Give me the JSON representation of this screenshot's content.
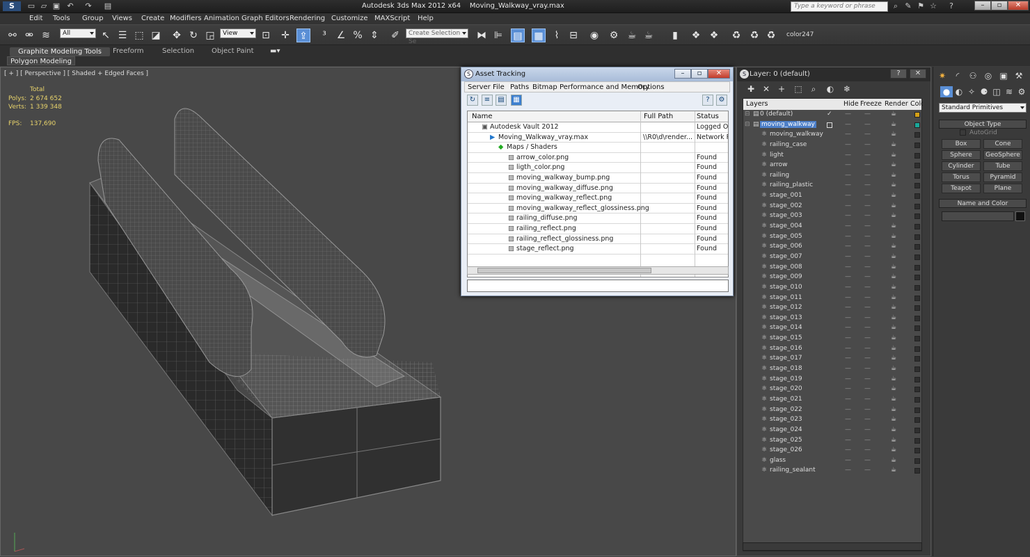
{
  "app_title": "Autodesk 3ds Max  2012 x64",
  "file_title": "Moving_Walkway_vray.max",
  "search_placeholder": "Type a keyword or phrase",
  "menu": [
    "Edit",
    "Tools",
    "Group",
    "Views",
    "Create",
    "Modifiers",
    "Animation",
    "Graph Editors",
    "Rendering",
    "Customize",
    "MAXScript",
    "Help"
  ],
  "toolbar": {
    "filter_value": "All",
    "refcoord_value": "View",
    "selection_set_placeholder": "Create Selection Se",
    "color_label": "color247"
  },
  "ribbon": {
    "tabs": [
      "Graphite Modeling Tools",
      "Freeform",
      "Selection",
      "Object Paint"
    ],
    "sub_tab": "Polygon Modeling"
  },
  "viewport": {
    "label": "[ + ] [ Perspective ] [ Shaded + Edged Faces ]",
    "stats": {
      "header": "Total",
      "polys_label": "Polys:",
      "polys": "2 674 652",
      "verts_label": "Verts:",
      "verts": "1 339 348",
      "fps_label": "FPS:",
      "fps": "137,690"
    }
  },
  "asset_tracking": {
    "title": "Asset Tracking",
    "menu": [
      "Server",
      "File",
      "Paths",
      "Bitmap Performance and Memory",
      "Options"
    ],
    "columns": [
      "Name",
      "Full Path",
      "Status"
    ],
    "rows": [
      {
        "name": "Autodesk Vault 2012",
        "path": "",
        "status": "Logged Ou",
        "indent": 0
      },
      {
        "name": "Moving_Walkway_vray.max",
        "path": "\\\\R0\\d\\render...",
        "status": "Network Pa",
        "indent": 1
      },
      {
        "name": "Maps / Shaders",
        "path": "",
        "status": "",
        "indent": 2
      },
      {
        "name": "arrow_color.png",
        "path": "",
        "status": "Found",
        "indent": 3
      },
      {
        "name": "ligth_color.png",
        "path": "",
        "status": "Found",
        "indent": 3
      },
      {
        "name": "moving_walkway_bump.png",
        "path": "",
        "status": "Found",
        "indent": 3
      },
      {
        "name": "moving_walkway_diffuse.png",
        "path": "",
        "status": "Found",
        "indent": 3
      },
      {
        "name": "moving_walkway_reflect.png",
        "path": "",
        "status": "Found",
        "indent": 3
      },
      {
        "name": "moving_walkway_reflect_glossiness.png",
        "path": "",
        "status": "Found",
        "indent": 3
      },
      {
        "name": "railing_diffuse.png",
        "path": "",
        "status": "Found",
        "indent": 3
      },
      {
        "name": "railing_reflect.png",
        "path": "",
        "status": "Found",
        "indent": 3
      },
      {
        "name": "railing_reflect_glossiness.png",
        "path": "",
        "status": "Found",
        "indent": 3
      },
      {
        "name": "stage_reflect.png",
        "path": "",
        "status": "Found",
        "indent": 3
      }
    ]
  },
  "layers": {
    "title": "Layer: 0 (default)",
    "columns": [
      "Layers",
      "Hide",
      "Freeze",
      "Render",
      "Color"
    ],
    "rows": [
      {
        "name": "0 (default)",
        "level": 0,
        "check": "✓",
        "color": "#d4a017"
      },
      {
        "name": "moving_walkway",
        "level": 0,
        "selected": true,
        "color": "#1aa89a"
      },
      {
        "name": "moving_walkway",
        "level": 1
      },
      {
        "name": "railing_case",
        "level": 1
      },
      {
        "name": "light",
        "level": 1
      },
      {
        "name": "arrow",
        "level": 1
      },
      {
        "name": "railing",
        "level": 1
      },
      {
        "name": "railing_plastic",
        "level": 1
      },
      {
        "name": "stage_001",
        "level": 1
      },
      {
        "name": "stage_002",
        "level": 1
      },
      {
        "name": "stage_003",
        "level": 1
      },
      {
        "name": "stage_004",
        "level": 1
      },
      {
        "name": "stage_005",
        "level": 1
      },
      {
        "name": "stage_006",
        "level": 1
      },
      {
        "name": "stage_007",
        "level": 1
      },
      {
        "name": "stage_008",
        "level": 1
      },
      {
        "name": "stage_009",
        "level": 1
      },
      {
        "name": "stage_010",
        "level": 1
      },
      {
        "name": "stage_011",
        "level": 1
      },
      {
        "name": "stage_012",
        "level": 1
      },
      {
        "name": "stage_013",
        "level": 1
      },
      {
        "name": "stage_014",
        "level": 1
      },
      {
        "name": "stage_015",
        "level": 1
      },
      {
        "name": "stage_016",
        "level": 1
      },
      {
        "name": "stage_017",
        "level": 1
      },
      {
        "name": "stage_018",
        "level": 1
      },
      {
        "name": "stage_019",
        "level": 1
      },
      {
        "name": "stage_020",
        "level": 1
      },
      {
        "name": "stage_021",
        "level": 1
      },
      {
        "name": "stage_022",
        "level": 1
      },
      {
        "name": "stage_023",
        "level": 1
      },
      {
        "name": "stage_024",
        "level": 1
      },
      {
        "name": "stage_025",
        "level": 1
      },
      {
        "name": "stage_026",
        "level": 1
      },
      {
        "name": "glass",
        "level": 1
      },
      {
        "name": "railing_sealant",
        "level": 1
      }
    ]
  },
  "command_panel": {
    "dropdown": "Standard Primitives",
    "rollout_object_type": "Object Type",
    "autogrid": "AutoGrid",
    "buttons": [
      "Box",
      "Cone",
      "Sphere",
      "GeoSphere",
      "Cylinder",
      "Tube",
      "Torus",
      "Pyramid",
      "Teapot",
      "Plane"
    ],
    "rollout_name_color": "Name and Color"
  }
}
